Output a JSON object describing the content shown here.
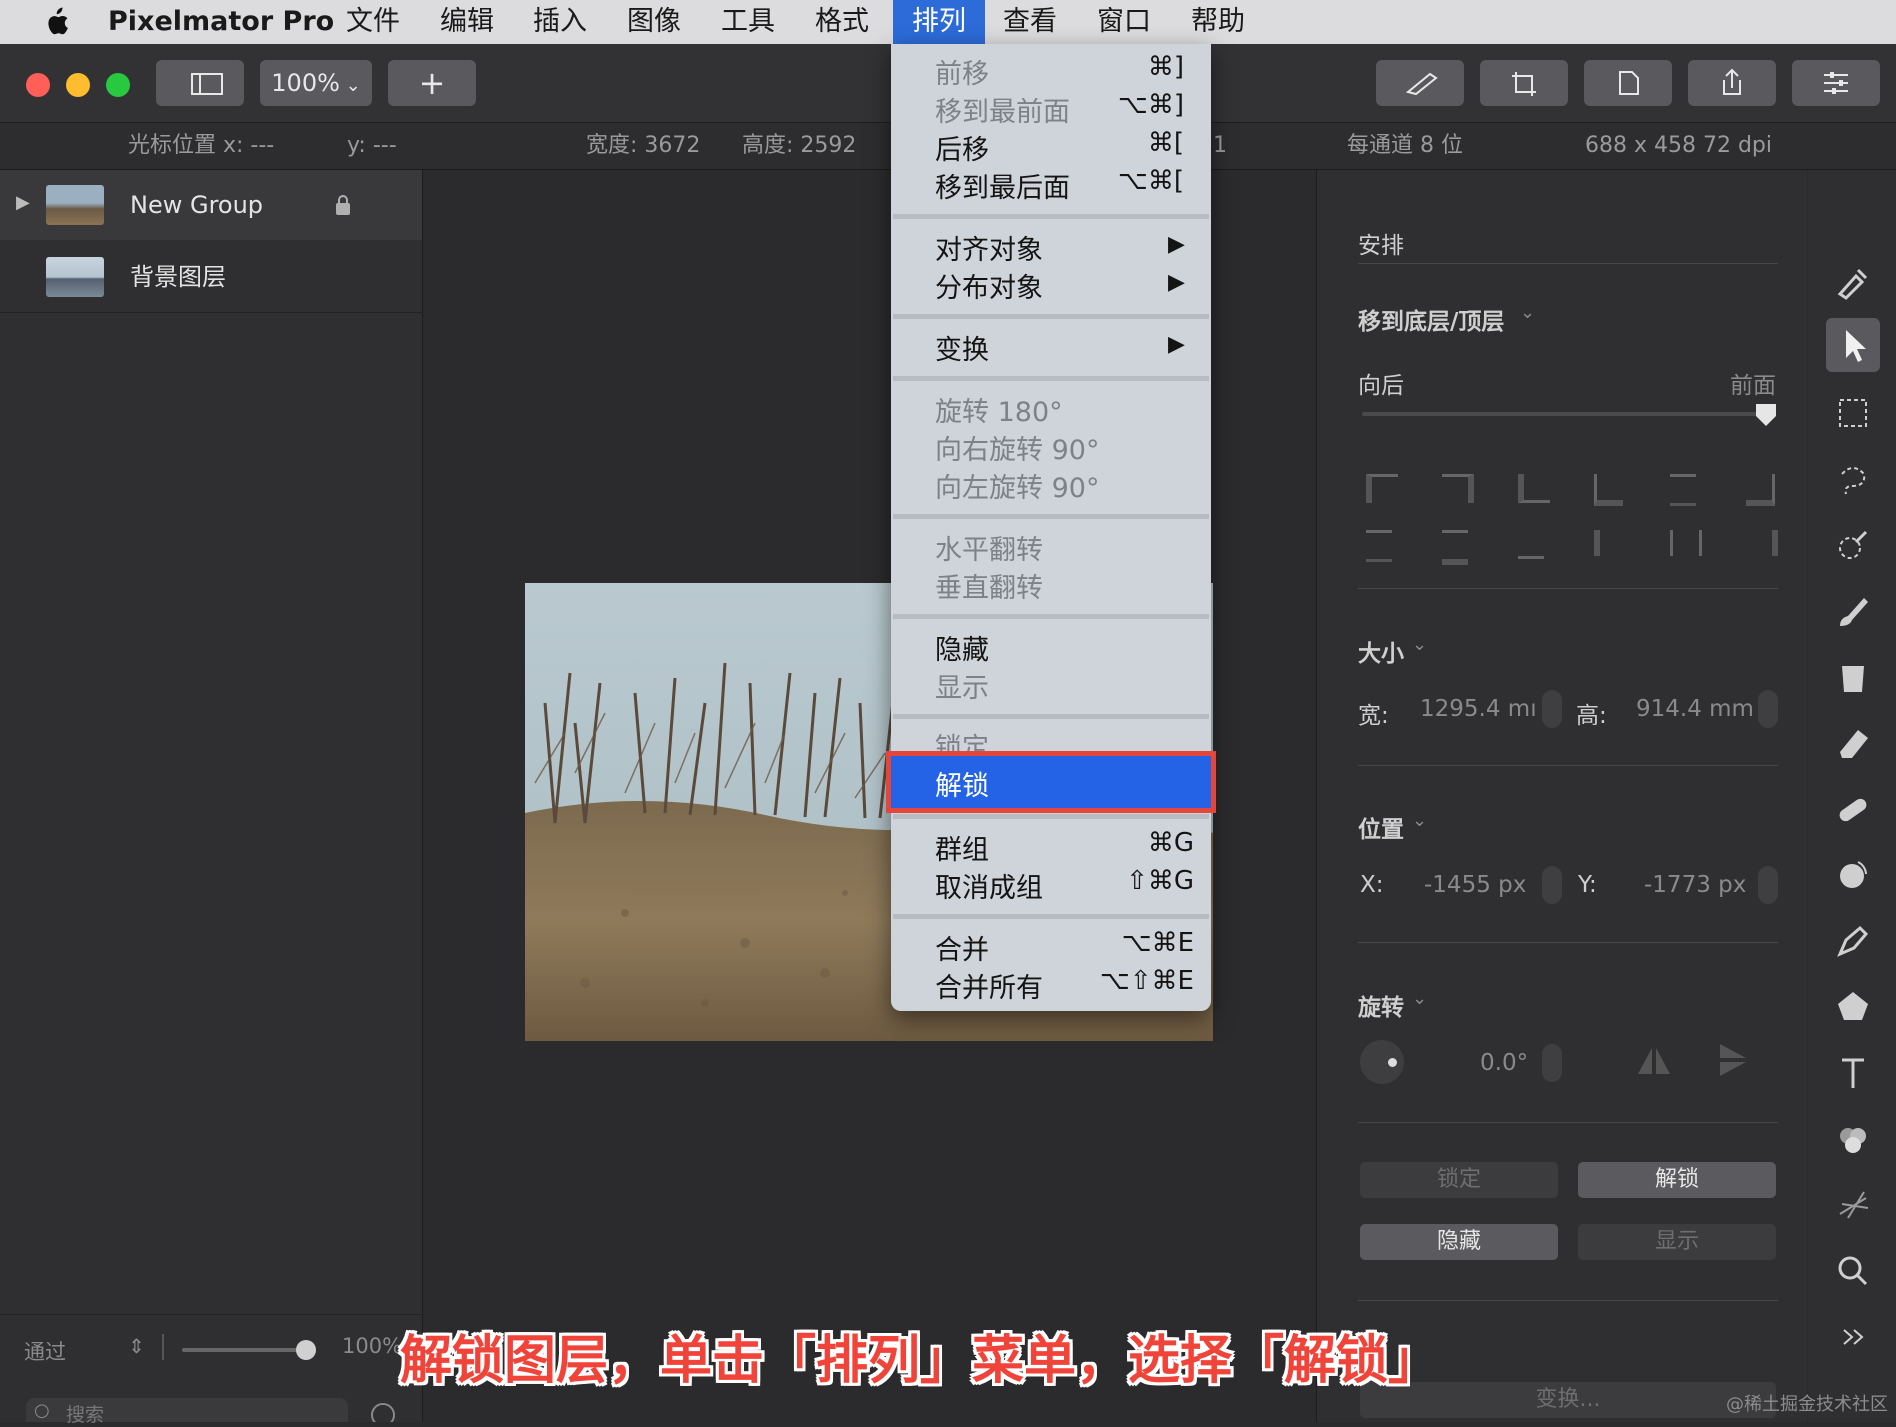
{
  "menubar": {
    "app_name": "Pixelmator Pro",
    "items": [
      "文件",
      "编辑",
      "插入",
      "图像",
      "工具",
      "格式",
      "排列",
      "查看",
      "窗口",
      "帮助"
    ],
    "active": "排列"
  },
  "toolbar": {
    "zoom": "100%",
    "add_label": "+"
  },
  "infobar": {
    "cursor_x": "光标位置 x:  ---",
    "cursor_y": "y:  ---",
    "width": "宽度:  3672",
    "height": "高度:  2592",
    "bit_depth": "每通道 8 位",
    "resolution": "688 x 458 72 dpi",
    "partial": "1"
  },
  "layers": {
    "items": [
      {
        "name": "New Group",
        "locked": true,
        "expandable": true
      },
      {
        "name": "背景图层",
        "locked": false,
        "expandable": false
      }
    ],
    "blend_mode": "通过",
    "opacity": "100%",
    "search_placeholder": "搜索"
  },
  "arrange_menu": {
    "items": [
      {
        "label": "前移",
        "shortcut": "⌘]",
        "enabled": false
      },
      {
        "label": "移到最前面",
        "shortcut": "⌥⌘]",
        "enabled": false
      },
      {
        "label": "后移",
        "shortcut": "⌘[",
        "enabled": true
      },
      {
        "label": "移到最后面",
        "shortcut": "⌥⌘[",
        "enabled": true
      },
      {
        "label": "对齐对象",
        "submenu": true,
        "enabled": true
      },
      {
        "label": "分布对象",
        "submenu": true,
        "enabled": true
      },
      {
        "label": "变换",
        "submenu": true,
        "enabled": true
      },
      {
        "label": "旋转 180°",
        "enabled": false
      },
      {
        "label": "向右旋转 90°",
        "enabled": false
      },
      {
        "label": "向左旋转 90°",
        "enabled": false
      },
      {
        "label": "水平翻转",
        "enabled": false
      },
      {
        "label": "垂直翻转",
        "enabled": false
      },
      {
        "label": "隐藏",
        "enabled": true
      },
      {
        "label": "显示",
        "enabled": false
      },
      {
        "label": "锁定",
        "enabled": false
      },
      {
        "label": "解锁",
        "enabled": true,
        "highlighted": true
      },
      {
        "label": "群组",
        "shortcut": "⌘G",
        "enabled": true
      },
      {
        "label": "取消成组",
        "shortcut": "⇧⌘G",
        "enabled": true
      },
      {
        "label": "合并",
        "shortcut": "⌥⌘E",
        "enabled": true
      },
      {
        "label": "合并所有",
        "shortcut": "⌥⇧⌘E",
        "enabled": true
      }
    ]
  },
  "inspector": {
    "section_title": "安排",
    "order_label": "移到底层/顶层",
    "backward_label": "向后",
    "forward_label": "前面",
    "order_slider_value": 1.0,
    "size_label": "大小",
    "width_label": "宽:",
    "width_value": "1295.4 mı",
    "height_label": "高:",
    "height_value": "914.4 mm",
    "position_label": "位置",
    "x_label": "X:",
    "x_value": "-1455 px",
    "y_label": "Y:",
    "y_value": "-1773 px",
    "rotation_label": "旋转",
    "rotation_value": "0.0°",
    "lock_button": "锁定",
    "unlock_button": "解锁",
    "hide_button": "隐藏",
    "show_button": "显示",
    "transform_button": "变换..."
  },
  "caption": "解锁图层，单击「排列」菜单，选择「解锁」",
  "watermark": "@稀土掘金技术社区",
  "colors": {
    "menu_highlight": "#2563e6",
    "highlight_border": "#e5463b",
    "caption": "#f0443a",
    "traffic_red": "#ff5f57",
    "traffic_yellow": "#febc2e",
    "traffic_green": "#28c840"
  }
}
